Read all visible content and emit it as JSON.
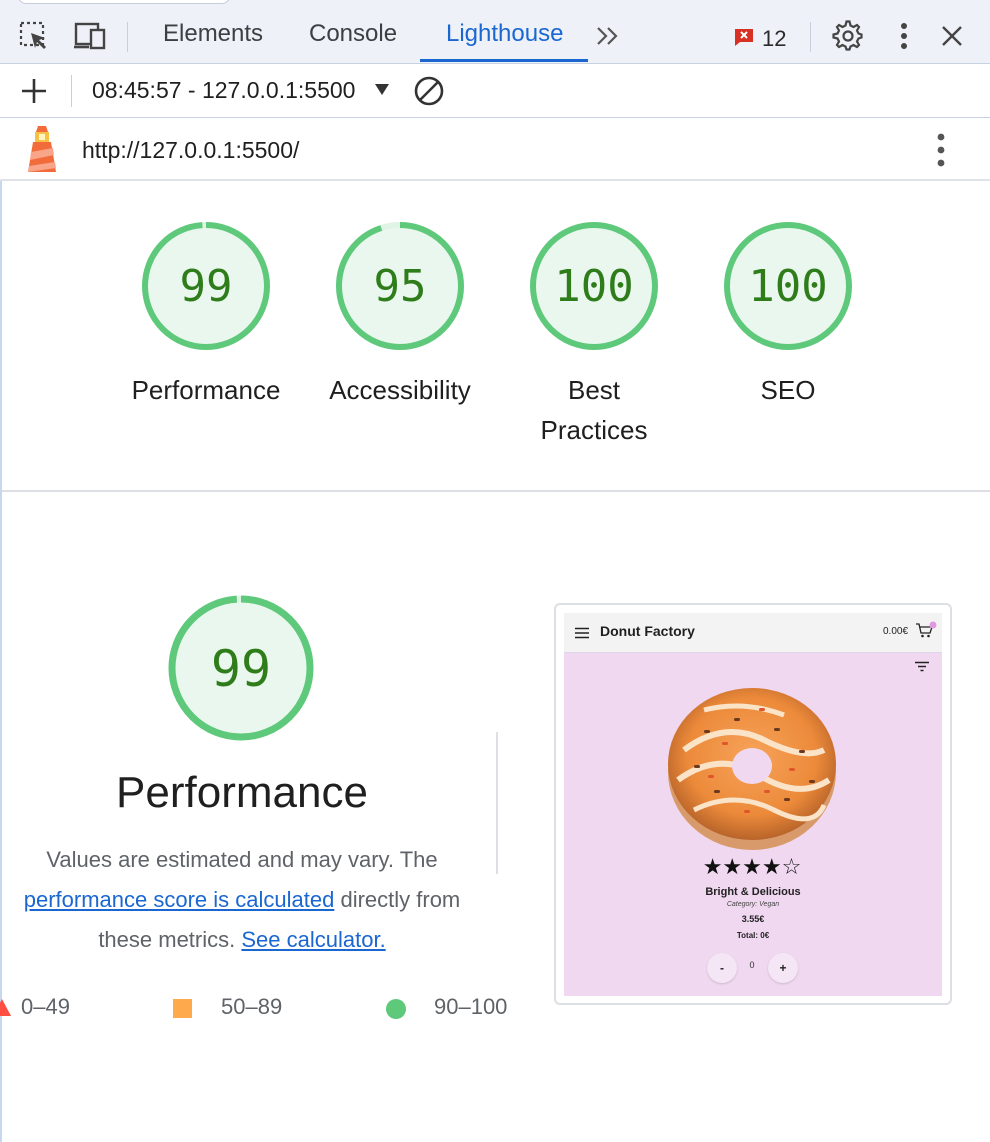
{
  "tabs": {
    "elements": "Elements",
    "console": "Console",
    "lighthouse": "Lighthouse"
  },
  "issues": {
    "count": "12"
  },
  "toolbar": {
    "report_select": "08:45:57 - 127.0.0.1:5500"
  },
  "report": {
    "url": "http://127.0.0.1:5500/"
  },
  "gauges": [
    {
      "score": "99",
      "label": "Performance"
    },
    {
      "score": "95",
      "label": "Accessibility"
    },
    {
      "score": "100",
      "label": "Best Practices",
      "line1": "Best",
      "line2": "Practices"
    },
    {
      "score": "100",
      "label": "SEO"
    }
  ],
  "performance": {
    "score": "99",
    "title": "Performance",
    "desc_prefix": "Values are estimated and may vary. The",
    "desc_link": "performance score is calculated",
    "desc_mid": "directly from",
    "desc_line3": "these metrics.",
    "desc_link2": "See calculator."
  },
  "legend": {
    "fail": "0–49",
    "average": "50–89",
    "pass": "90–100"
  },
  "screenshot": {
    "site_title": "Donut Factory",
    "cart_total": "0.00€",
    "stars": "★★★★☆",
    "product_name": "Bright & Delicious",
    "category": "Category: Vegan",
    "price": "3.55€",
    "total": "Total: 0€",
    "minus": "-",
    "qty": "0",
    "plus": "+"
  },
  "colors": {
    "pass_green": "#0cce6b",
    "pass_text": "#2e7d1a",
    "average_orange": "#ffa400",
    "accent_blue": "#1a67d2"
  }
}
